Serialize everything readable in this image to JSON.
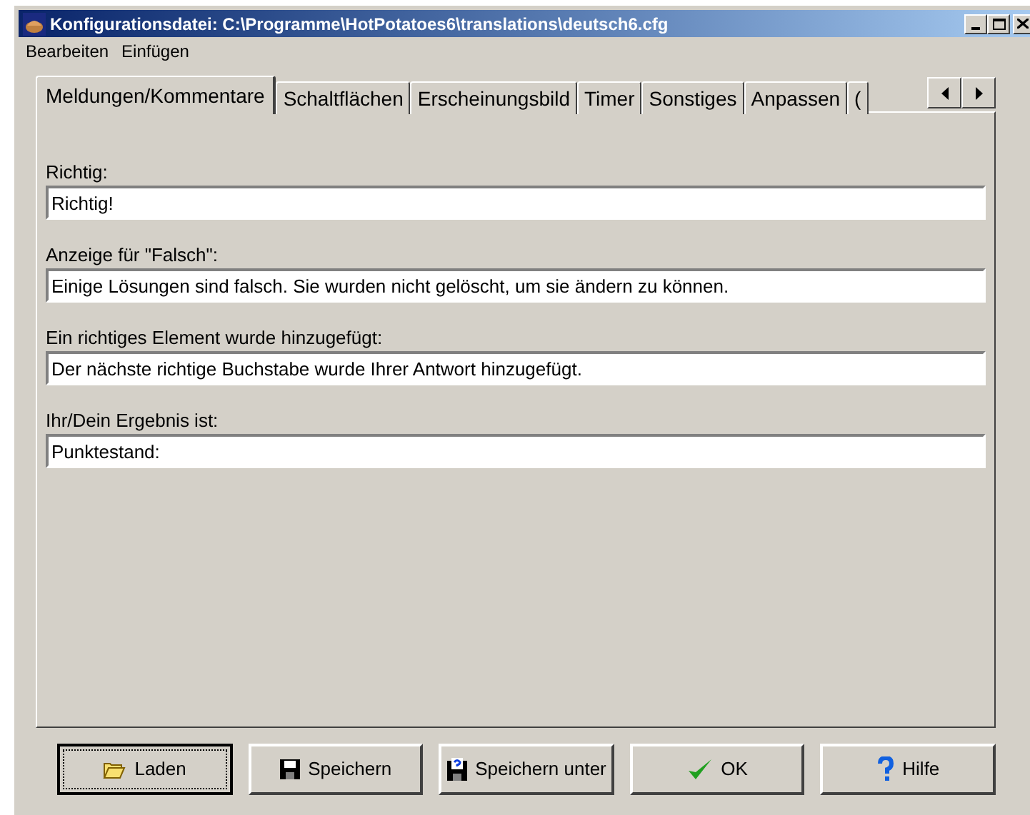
{
  "window": {
    "title": "Konfigurationsdatei: C:\\Programme\\HotPotatoes6\\translations\\deutsch6.cfg"
  },
  "menu": [
    "Bearbeiten",
    "Einfügen"
  ],
  "tabs": [
    {
      "label": "Meldungen/Kommentare",
      "selected": true
    },
    {
      "label": "Schaltflächen",
      "selected": false
    },
    {
      "label": "Erscheinungsbild",
      "selected": false
    },
    {
      "label": "Timer",
      "selected": false
    },
    {
      "label": "Sonstiges",
      "selected": false
    },
    {
      "label": "Anpassen",
      "selected": false
    },
    {
      "label": "(",
      "selected": false
    }
  ],
  "fields": [
    {
      "label": "Richtig:",
      "value": "Richtig!"
    },
    {
      "label": "Anzeige für \"Falsch\":",
      "value": "Einige Lösungen sind falsch. Sie wurden nicht gelöscht, um sie ändern zu können."
    },
    {
      "label": "Ein richtiges Element wurde hinzugefügt:",
      "value": "Der nächste richtige Buchstabe wurde Ihrer Antwort hinzugefügt."
    },
    {
      "label": "Ihr/Dein Ergebnis ist:",
      "value": "Punktestand:"
    }
  ],
  "buttons": [
    {
      "kind": "open",
      "label": "Laden",
      "focused": true
    },
    {
      "kind": "save",
      "label": "Speichern",
      "focused": false
    },
    {
      "kind": "saveas",
      "label": "Speichern unter",
      "focused": false
    },
    {
      "kind": "ok",
      "label": "OK",
      "focused": false
    },
    {
      "kind": "help",
      "label": "Hilfe",
      "focused": false
    }
  ]
}
